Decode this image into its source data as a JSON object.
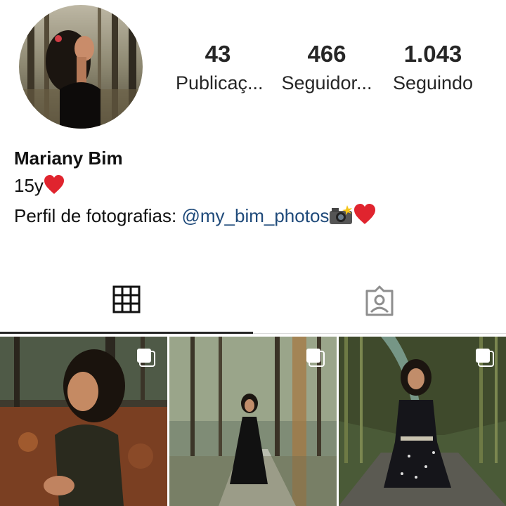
{
  "profile": {
    "avatar_icon": "profile-photo-woman-in-forest",
    "stats": [
      {
        "value": "43",
        "label": "Publicaç..."
      },
      {
        "value": "466",
        "label": "Seguidor..."
      },
      {
        "value": "1.043",
        "label": "Seguindo"
      }
    ],
    "name": "Mariany Bim",
    "bio_line1": "15y",
    "bio_line2_prefix": "Perfil de fotografias: ",
    "bio_link": "@my_bim_photos",
    "emoji_heart": "red-heart-icon",
    "emoji_camera": "camera-flash-icon"
  },
  "tabs": [
    {
      "name": "grid-tab",
      "icon": "grid-icon",
      "active": true
    },
    {
      "name": "tagged-tab",
      "icon": "tagged-person-icon",
      "active": false
    }
  ],
  "posts": [
    {
      "icon": "multiple-photos-icon",
      "subject": "girl smiling in autumn leaves"
    },
    {
      "icon": "multiple-photos-icon",
      "subject": "girl in black dress on forest path"
    },
    {
      "icon": "multiple-photos-icon",
      "subject": "girl in polka dot dress in bamboo alley"
    }
  ],
  "colors": {
    "text": "#262626",
    "link": "#1f4a7a",
    "heart": "#e0242e",
    "divider": "#dbdbdb"
  }
}
